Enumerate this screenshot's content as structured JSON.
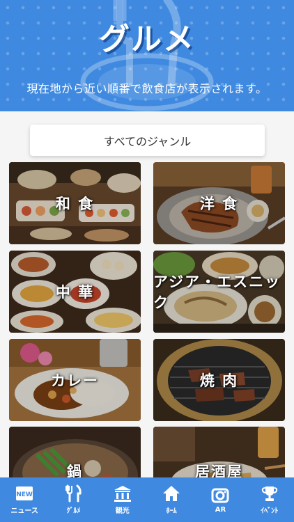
{
  "header": {
    "title": "グルメ",
    "subtitle": "現在地から近い順番で飲食店が表示されます。"
  },
  "genre_select": {
    "label": "すべてのジャンル"
  },
  "categories": [
    {
      "label": "和 食",
      "photo": "japanese-food-photo"
    },
    {
      "label": "洋 食",
      "photo": "western-food-photo"
    },
    {
      "label": "中 華",
      "photo": "chinese-food-photo"
    },
    {
      "label": "アジア・エスニック",
      "photo": "asian-ethnic-food-photo"
    },
    {
      "label": "カレー",
      "photo": "curry-photo"
    },
    {
      "label": "焼 肉",
      "photo": "yakiniku-photo"
    },
    {
      "label": "鍋",
      "photo": "hotpot-photo"
    },
    {
      "label": "居酒屋",
      "photo": "izakaya-photo"
    }
  ],
  "tabbar": {
    "items": [
      {
        "label": "ニュース",
        "icon": "news-icon"
      },
      {
        "label": "ｸﾞﾙﾒ",
        "icon": "fork-knife-icon"
      },
      {
        "label": "観光",
        "icon": "temple-icon"
      },
      {
        "label": "ﾎｰﾑ",
        "icon": "home-icon"
      },
      {
        "label": "AR",
        "icon": "camera-icon"
      },
      {
        "label": "ｲﾍﾞﾝﾄ",
        "icon": "trophy-icon"
      }
    ],
    "news_badge": "NEW"
  },
  "colors": {
    "brand": "#3f8ae0",
    "tile_overlay": "#000000"
  }
}
